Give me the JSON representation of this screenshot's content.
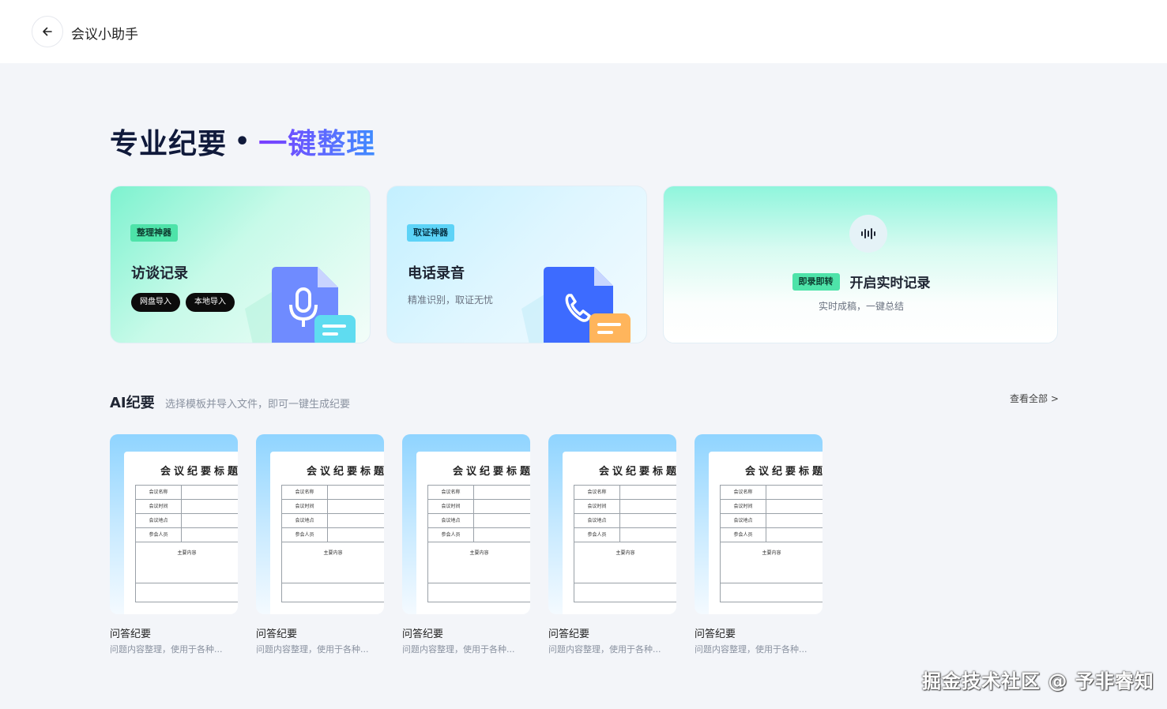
{
  "header": {
    "title": "会议小助手",
    "back_icon": "arrow-left-icon"
  },
  "hero": {
    "title_part1": "专业纪要",
    "separator": "•",
    "title_part2": "一键整理"
  },
  "cards": [
    {
      "badge": "整理神器",
      "title": "访谈记录",
      "buttons": [
        "网盘导入",
        "本地导入"
      ],
      "icon": "microphone-document-icon"
    },
    {
      "badge": "取证神器",
      "title": "电话录音",
      "subtitle": "精准识别，取证无忧",
      "icon": "phone-document-icon"
    },
    {
      "badge": "即录即转",
      "title": "开启实时记录",
      "subtitle": "实时成稿，一键总结",
      "icon": "audio-wave-icon"
    }
  ],
  "ai_section": {
    "title": "AI纪要",
    "description": "选择模板并导入文件，即可一键生成纪要",
    "view_all": "查看全部 >"
  },
  "templates": [
    {
      "name": "问答纪要",
      "desc": "问题内容整理，使用于各种..."
    },
    {
      "name": "问答纪要",
      "desc": "问题内容整理，使用于各种..."
    },
    {
      "name": "问答纪要",
      "desc": "问题内容整理，使用于各种..."
    },
    {
      "name": "问答纪要",
      "desc": "问题内容整理，使用于各种..."
    },
    {
      "name": "问答纪要",
      "desc": "问题内容整理，使用于各种..."
    }
  ],
  "template_preview": {
    "title": "会议纪要标题",
    "rows": [
      "会议名称",
      "会议时间",
      "会议地点",
      "参会人员"
    ],
    "main": "主要内容"
  },
  "watermark": "掘金技术社区 @ 予非睿知",
  "colors": {
    "accent_green": "#4ee3a9",
    "accent_blue": "#5dd3f7",
    "hero_gradient_start": "#7a3cff",
    "hero_gradient_end": "#3f8cff",
    "doc_blue": "#3d6bff",
    "doc_purple": "#6f7dff"
  }
}
